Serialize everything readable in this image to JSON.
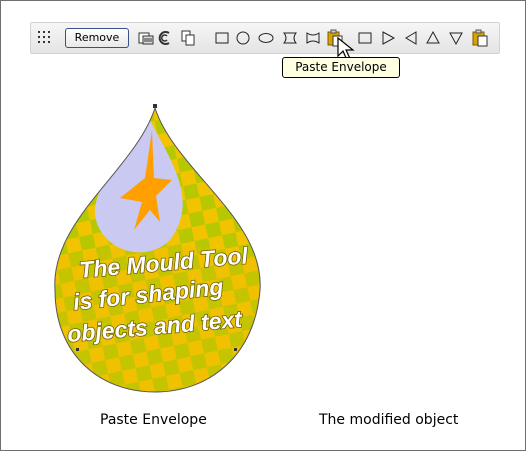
{
  "toolbar": {
    "remove_label": "Remove",
    "tools": [
      {
        "name": "grip-icon"
      },
      {
        "name": "copy-envelope-icon"
      },
      {
        "name": "copy-perspective-icon"
      },
      {
        "name": "clipboard-copy-icon"
      },
      {
        "name": "rectangle-envelope-icon"
      },
      {
        "name": "circle-envelope-icon"
      },
      {
        "name": "ellipse-envelope-icon"
      },
      {
        "name": "bowtie-envelope-icon"
      },
      {
        "name": "pinch-envelope-icon"
      },
      {
        "name": "paste-envelope-icon"
      },
      {
        "name": "square-perspective-icon"
      },
      {
        "name": "right-perspective-icon"
      },
      {
        "name": "left-perspective-icon"
      },
      {
        "name": "up-perspective-icon"
      },
      {
        "name": "down-perspective-icon"
      },
      {
        "name": "paste-perspective-icon"
      }
    ]
  },
  "tooltip": {
    "text": "Paste Envelope"
  },
  "artwork": {
    "text_lines": [
      "The Mould Tool",
      "is for shaping",
      "objects and text"
    ],
    "colors": {
      "yellow": "#f2c400",
      "green": "#b8c800",
      "star": "#ff9f00",
      "circle": "#c9c9f2",
      "text": "#ffffff",
      "shadow": "#6b5a00"
    }
  },
  "captions": {
    "left": "Paste Envelope",
    "right": "The modified object"
  }
}
